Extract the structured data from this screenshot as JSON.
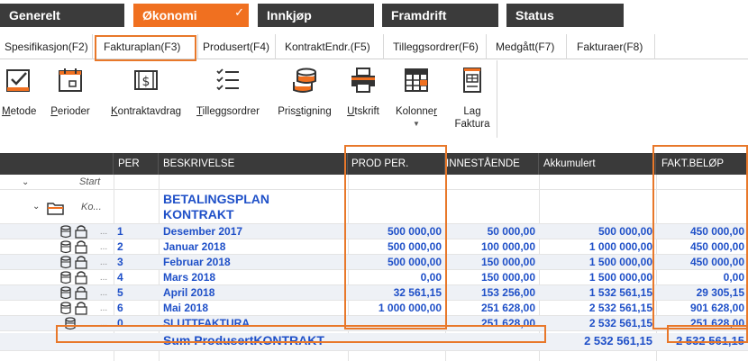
{
  "main_tabs": [
    {
      "label": "Generelt"
    },
    {
      "label": "Økonomi",
      "check": "✓"
    },
    {
      "label": "Innkjøp"
    },
    {
      "label": "Framdrift"
    },
    {
      "label": "Status"
    }
  ],
  "sub_tabs": [
    {
      "label": "Spesifikasjon(F2)"
    },
    {
      "label": "Fakturaplan(F3)"
    },
    {
      "label": "Produsert(F4)"
    },
    {
      "label": "KontraktEndr.(F5)"
    },
    {
      "label": "Tilleggsordrer(F6)"
    },
    {
      "label": "Medgått(F7)"
    },
    {
      "label": "Fakturaer(F8)"
    }
  ],
  "toolbar": {
    "metode_u": "M",
    "metode_rest": "etode",
    "perioder_u": "P",
    "perioder_rest": "erioder",
    "kontrakt_u": "K",
    "kontrakt_rest": "ontraktavdrag",
    "tillegg_u": "T",
    "tillegg_rest": "illeggsordrer",
    "pris_pre": "Pris",
    "pris_u": "s",
    "pris_rest": "tigning",
    "utskrift_u": "U",
    "utskrift_rest": "tskrift",
    "kolonner_pre": "Kolonne",
    "kolonner_u": "r",
    "lag_line1": "Lag",
    "lag_line2": "Faktura"
  },
  "grid": {
    "headers": {
      "per": "PER",
      "beskrivelse": "BESKRIVELSE",
      "prod_per": "PROD PER.",
      "innestaende": "INNESTÅENDE",
      "akkumulert": "Akkumulert",
      "fakt_belop": "FAKT.BELØP"
    },
    "start_label": "Start",
    "folder_label": "Ko...",
    "plan_title_1": "BETALINGSPLAN",
    "plan_title_2": "KONTRAKT",
    "rows": [
      {
        "per": "1",
        "beskrivelse": "Desember 2017",
        "prod": "500 000,00",
        "inne": "50 000,00",
        "akk": "500 000,00",
        "fakt": "450 000,00"
      },
      {
        "per": "2",
        "beskrivelse": "Januar 2018",
        "prod": "500 000,00",
        "inne": "100 000,00",
        "akk": "1 000 000,00",
        "fakt": "450 000,00"
      },
      {
        "per": "3",
        "beskrivelse": "Februar 2018",
        "prod": "500 000,00",
        "inne": "150 000,00",
        "akk": "1 500 000,00",
        "fakt": "450 000,00"
      },
      {
        "per": "4",
        "beskrivelse": "Mars 2018",
        "prod": "0,00",
        "inne": "150 000,00",
        "akk": "1 500 000,00",
        "fakt": "0,00"
      },
      {
        "per": "5",
        "beskrivelse": "April 2018",
        "prod": "32 561,15",
        "inne": "153 256,00",
        "akk": "1 532 561,15",
        "fakt": "29 305,15"
      },
      {
        "per": "6",
        "beskrivelse": "Mai 2018",
        "prod": "1 000 000,00",
        "inne": "251 628,00",
        "akk": "2 532 561,15",
        "fakt": "901 628,00"
      },
      {
        "per": "0",
        "beskrivelse": "SLUTTFAKTURA",
        "prod": "",
        "inne": "251 628,00",
        "akk": "2 532 561,15",
        "fakt": "251 628,00"
      }
    ],
    "sum": {
      "beskrivelse": "Sum ProdusertKONTRAKT",
      "akk": "2 532 561,15",
      "fakt": "2 532 561,15"
    },
    "dots": "..."
  },
  "colors": {
    "accent": "#f07020",
    "highlight": "#e8782a",
    "value_blue": "#1f50c8",
    "header_dark": "#3a3a3a"
  }
}
